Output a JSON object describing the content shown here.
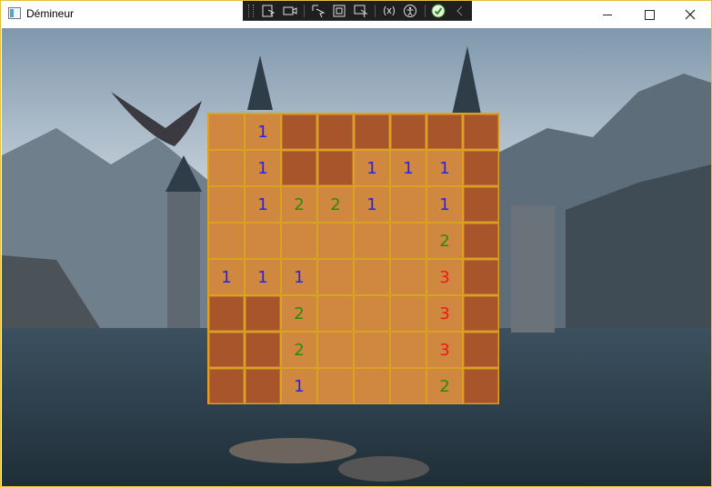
{
  "window": {
    "title": "Démineur"
  },
  "toolbar": {
    "buttons": [
      "select-element-icon",
      "record-icon",
      "pointer-icon",
      "frame-icon",
      "cursor-icon",
      "hot-reload-icon",
      "accessibility-icon",
      "check-icon",
      "collapse-icon"
    ]
  },
  "colors": {
    "hidden": "#a9552c",
    "open": "#d0873f",
    "grid": "#d9a321",
    "n1": "#2424ee",
    "n2": "#2a8a10",
    "n3": "#ee1a1a"
  },
  "board": {
    "rows": 8,
    "cols": 8,
    "cells": [
      [
        "open",
        "1",
        "h",
        "h",
        "h",
        "h",
        "h",
        "h"
      ],
      [
        "open",
        "1",
        "h",
        "h",
        "1",
        "1",
        "1",
        "h"
      ],
      [
        "open",
        "1",
        "2",
        "2",
        "1",
        "open",
        "1",
        "h"
      ],
      [
        "open",
        "open",
        "open",
        "open",
        "open",
        "open",
        "2",
        "h"
      ],
      [
        "1",
        "1",
        "1",
        "open",
        "open",
        "open",
        "3",
        "h"
      ],
      [
        "h",
        "h",
        "2",
        "open",
        "open",
        "open",
        "3",
        "h"
      ],
      [
        "h",
        "h",
        "2",
        "open",
        "open",
        "open",
        "3",
        "h"
      ],
      [
        "h",
        "h",
        "1",
        "open",
        "open",
        "open",
        "2",
        "h"
      ]
    ]
  }
}
